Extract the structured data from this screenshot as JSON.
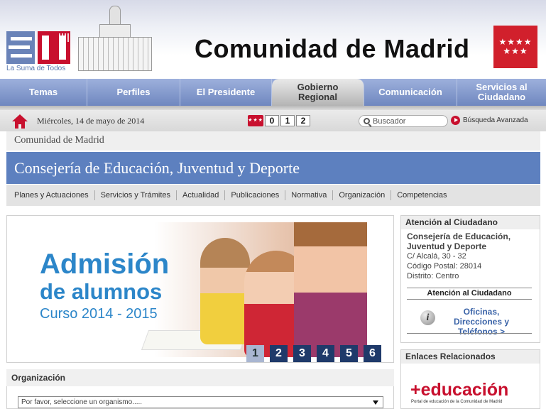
{
  "header": {
    "tagline": "La Suma de Todos",
    "site_title": "Comunidad de Madrid",
    "flag_stars": "★★★★ ★★★"
  },
  "nav": {
    "items": [
      {
        "label": "Temas",
        "active": false
      },
      {
        "label": "Perfiles",
        "active": false
      },
      {
        "label": "El Presidente",
        "active": false
      },
      {
        "label": "Gobierno Regional",
        "active": true
      },
      {
        "label": "Comunicación",
        "active": false
      },
      {
        "label": "Servicios al Ciudadano",
        "active": false
      }
    ]
  },
  "info_bar": {
    "date": "Miércoles, 14 de mayo de 2014",
    "counter_digits": [
      "0",
      "1",
      "2"
    ],
    "search_placeholder": "Buscador",
    "advanced_search": "Búsqueda Avanzada"
  },
  "breadcrumb": "Comunidad de Madrid",
  "department_title": "Consejería de Educación, Juventud y Deporte",
  "subnav": [
    "Planes y Actuaciones",
    "Servicios y Trámites",
    "Actualidad",
    "Publicaciones",
    "Normativa",
    "Organización",
    "Competencias"
  ],
  "banner": {
    "line1": "Admisión",
    "line2": "de alumnos",
    "line3": "Curso 2014 - 2015",
    "pages": [
      "1",
      "2",
      "3",
      "4",
      "5",
      "6"
    ],
    "current_page": "1"
  },
  "organizacion": {
    "title": "Organización",
    "select_value": "Por favor, seleccione un organismo....."
  },
  "atencion": {
    "title": "Atención al Ciudadano",
    "dept_name": "Consejería de Educación, Juventud y Deporte",
    "address": "C/ Alcalá, 30 - 32",
    "postal": "Código Postal: 28014",
    "district": "Distrito: Centro",
    "subheading": "Atención al Ciudadano",
    "link": "Oficinas, Direcciones y Teléfonos  >"
  },
  "enlaces": {
    "title": "Enlaces Relacionados",
    "logo_text": "+educación",
    "logo_sub": "Portal de educación de la Comunidad de Madrid"
  },
  "colors": {
    "brand_red": "#c8102e",
    "nav_blue": "#6f87bf",
    "dept_blue": "#5d80bf",
    "banner_blue": "#2c86c9",
    "pager_navy": "#1f3a6a"
  }
}
